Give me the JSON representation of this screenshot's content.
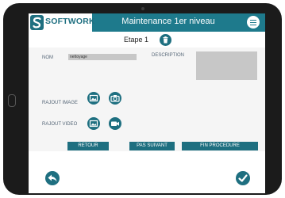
{
  "header": {
    "brand": "SOFTWORK",
    "title": "Maintenance 1er niveau"
  },
  "step": {
    "label": "Etape 1"
  },
  "form": {
    "nom_label": "NOM",
    "nom_value": "nettoyage",
    "description_label": "DESCRIPTION",
    "image_label": "RAJOUT IMAGE",
    "video_label": "RAJOUT VIDEO"
  },
  "actions": {
    "retour": "RETOUR",
    "pas_suivant": "PAS SUIVANT",
    "fin_procedure": "FIN PROCEDURE"
  },
  "colors": {
    "accent": "#1e7a8c",
    "frame": "#1b1b1b",
    "field": "#c7c7c7"
  },
  "icons": [
    "menu-icon",
    "trash-icon",
    "gallery-icon",
    "camera-icon",
    "video-camera-icon",
    "back-arrow-icon",
    "check-icon"
  ]
}
